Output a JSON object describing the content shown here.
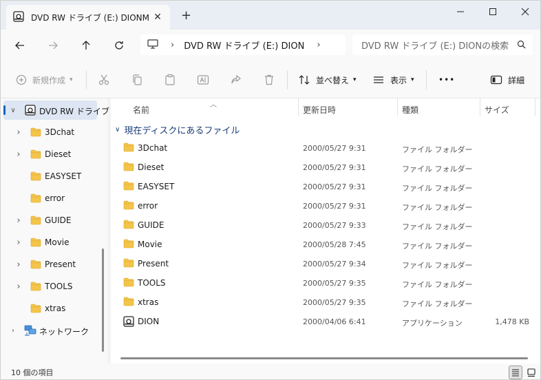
{
  "window": {
    "tab_title": "DVD RW ドライブ (E:) DIONM",
    "tab_close": "✕",
    "new_tab": "+"
  },
  "address": {
    "path": "DVD RW ドライブ (E:) DION",
    "separator": "›",
    "trailing_chevron": "›"
  },
  "search": {
    "placeholder": "DVD RW ドライブ (E:) DIONの検索"
  },
  "toolbar": {
    "new_label": "新規作成",
    "sort_label": "並べ替え",
    "view_label": "表示",
    "more_label": "•••",
    "details_label": "詳細"
  },
  "nav": {
    "items": [
      {
        "label": "DVD RW ドライブ",
        "type": "drive",
        "expanded": true,
        "selected": true
      },
      {
        "label": "3Dchat",
        "type": "folder",
        "chevron": true
      },
      {
        "label": "Dieset",
        "type": "folder",
        "chevron": true
      },
      {
        "label": "EASYSET",
        "type": "folder",
        "chevron": false
      },
      {
        "label": "error",
        "type": "folder",
        "chevron": false
      },
      {
        "label": "GUIDE",
        "type": "folder",
        "chevron": true
      },
      {
        "label": "Movie",
        "type": "folder",
        "chevron": true
      },
      {
        "label": "Present",
        "type": "folder",
        "chevron": true
      },
      {
        "label": "TOOLS",
        "type": "folder",
        "chevron": true
      },
      {
        "label": "xtras",
        "type": "folder",
        "chevron": false
      },
      {
        "label": "ネットワーク",
        "type": "network",
        "chevron": true
      }
    ]
  },
  "columns": {
    "name": "名前",
    "date": "更新日時",
    "type": "種類",
    "size": "サイズ"
  },
  "group": {
    "label": "現在ディスクにあるファイル"
  },
  "files": [
    {
      "name": "3Dchat",
      "date": "2000/05/27 9:31",
      "type": "ファイル フォルダー",
      "size": "",
      "icon": "folder"
    },
    {
      "name": "Dieset",
      "date": "2000/05/27 9:31",
      "type": "ファイル フォルダー",
      "size": "",
      "icon": "folder"
    },
    {
      "name": "EASYSET",
      "date": "2000/05/27 9:31",
      "type": "ファイル フォルダー",
      "size": "",
      "icon": "folder"
    },
    {
      "name": "error",
      "date": "2000/05/27 9:31",
      "type": "ファイル フォルダー",
      "size": "",
      "icon": "folder"
    },
    {
      "name": "GUIDE",
      "date": "2000/05/27 9:33",
      "type": "ファイル フォルダー",
      "size": "",
      "icon": "folder"
    },
    {
      "name": "Movie",
      "date": "2000/05/28 7:45",
      "type": "ファイル フォルダー",
      "size": "",
      "icon": "folder"
    },
    {
      "name": "Present",
      "date": "2000/05/27 9:34",
      "type": "ファイル フォルダー",
      "size": "",
      "icon": "folder"
    },
    {
      "name": "TOOLS",
      "date": "2000/05/27 9:35",
      "type": "ファイル フォルダー",
      "size": "",
      "icon": "folder"
    },
    {
      "name": "xtras",
      "date": "2000/05/27 9:35",
      "type": "ファイル フォルダー",
      "size": "",
      "icon": "folder"
    },
    {
      "name": "DION",
      "date": "2000/04/06 6:41",
      "type": "アプリケーション",
      "size": "1,478 KB",
      "icon": "application"
    }
  ],
  "status": {
    "item_count": "10 個の項目"
  },
  "colors": {
    "accent": "#0067c0",
    "folder": "#f4c54b",
    "group_text": "#1c3d7a"
  }
}
